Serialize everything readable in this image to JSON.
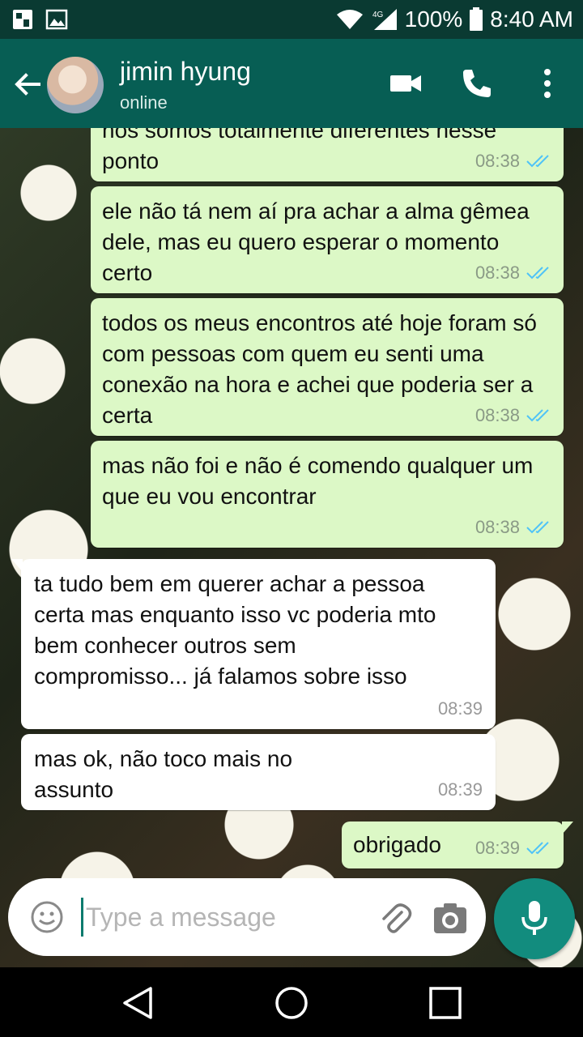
{
  "status_bar": {
    "network_label": "4G",
    "battery": "100%",
    "time": "8:40 AM"
  },
  "header": {
    "contact_name": "jimin hyung",
    "contact_status": "online"
  },
  "messages": [
    {
      "direction": "out",
      "text": "nós somos totalmente diferentes nesse ponto",
      "time": "08:38",
      "status": "read"
    },
    {
      "direction": "out",
      "text": "ele não tá nem aí pra achar a alma gêmea dele, mas eu quero esperar o momento certo",
      "time": "08:38",
      "status": "read"
    },
    {
      "direction": "out",
      "text": "todos os meus encontros até hoje foram só com pessoas com quem eu senti uma conexão na hora e achei que poderia ser a certa",
      "time": "08:38",
      "status": "read"
    },
    {
      "direction": "out",
      "text": "mas não foi e não é comendo qualquer um que eu vou encontrar",
      "time": "08:38",
      "status": "read"
    },
    {
      "direction": "in",
      "text": "ta tudo bem em querer achar a pessoa certa mas enquanto isso vc poderia mto bem conhecer outros sem compromisso... já falamos sobre isso",
      "time": "08:39"
    },
    {
      "direction": "in",
      "text": "mas ok, não toco mais no assunto",
      "time": "08:39"
    },
    {
      "direction": "out",
      "text": "obrigado",
      "time": "08:39",
      "status": "read"
    }
  ],
  "input": {
    "placeholder": "Type a message",
    "value": ""
  },
  "colors": {
    "header": "#075e54",
    "status_bar": "#0a3a32",
    "outgoing_bubble": "#dcf8c6",
    "incoming_bubble": "#ffffff",
    "read_tick": "#4fc3f7",
    "fab": "#128c7e"
  },
  "icons": [
    "sim-icon",
    "image-icon",
    "wifi-icon",
    "signal-icon",
    "battery-icon",
    "back-arrow-icon",
    "video-call-icon",
    "phone-icon",
    "more-vert-icon",
    "emoji-icon",
    "attach-icon",
    "camera-icon",
    "mic-icon",
    "nav-back-icon",
    "nav-home-icon",
    "nav-recents-icon"
  ]
}
